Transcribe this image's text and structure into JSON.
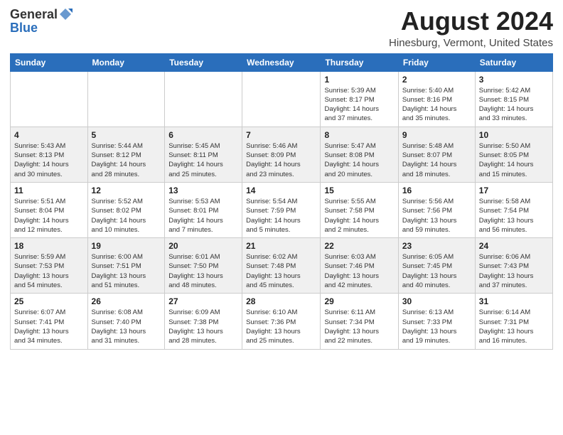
{
  "header": {
    "logo_general": "General",
    "logo_blue": "Blue",
    "title": "August 2024",
    "subtitle": "Hinesburg, Vermont, United States"
  },
  "calendar": {
    "days_of_week": [
      "Sunday",
      "Monday",
      "Tuesday",
      "Wednesday",
      "Thursday",
      "Friday",
      "Saturday"
    ],
    "weeks": [
      [
        {
          "day": "",
          "info": ""
        },
        {
          "day": "",
          "info": ""
        },
        {
          "day": "",
          "info": ""
        },
        {
          "day": "",
          "info": ""
        },
        {
          "day": "1",
          "info": "Sunrise: 5:39 AM\nSunset: 8:17 PM\nDaylight: 14 hours\nand 37 minutes."
        },
        {
          "day": "2",
          "info": "Sunrise: 5:40 AM\nSunset: 8:16 PM\nDaylight: 14 hours\nand 35 minutes."
        },
        {
          "day": "3",
          "info": "Sunrise: 5:42 AM\nSunset: 8:15 PM\nDaylight: 14 hours\nand 33 minutes."
        }
      ],
      [
        {
          "day": "4",
          "info": "Sunrise: 5:43 AM\nSunset: 8:13 PM\nDaylight: 14 hours\nand 30 minutes."
        },
        {
          "day": "5",
          "info": "Sunrise: 5:44 AM\nSunset: 8:12 PM\nDaylight: 14 hours\nand 28 minutes."
        },
        {
          "day": "6",
          "info": "Sunrise: 5:45 AM\nSunset: 8:11 PM\nDaylight: 14 hours\nand 25 minutes."
        },
        {
          "day": "7",
          "info": "Sunrise: 5:46 AM\nSunset: 8:09 PM\nDaylight: 14 hours\nand 23 minutes."
        },
        {
          "day": "8",
          "info": "Sunrise: 5:47 AM\nSunset: 8:08 PM\nDaylight: 14 hours\nand 20 minutes."
        },
        {
          "day": "9",
          "info": "Sunrise: 5:48 AM\nSunset: 8:07 PM\nDaylight: 14 hours\nand 18 minutes."
        },
        {
          "day": "10",
          "info": "Sunrise: 5:50 AM\nSunset: 8:05 PM\nDaylight: 14 hours\nand 15 minutes."
        }
      ],
      [
        {
          "day": "11",
          "info": "Sunrise: 5:51 AM\nSunset: 8:04 PM\nDaylight: 14 hours\nand 12 minutes."
        },
        {
          "day": "12",
          "info": "Sunrise: 5:52 AM\nSunset: 8:02 PM\nDaylight: 14 hours\nand 10 minutes."
        },
        {
          "day": "13",
          "info": "Sunrise: 5:53 AM\nSunset: 8:01 PM\nDaylight: 14 hours\nand 7 minutes."
        },
        {
          "day": "14",
          "info": "Sunrise: 5:54 AM\nSunset: 7:59 PM\nDaylight: 14 hours\nand 5 minutes."
        },
        {
          "day": "15",
          "info": "Sunrise: 5:55 AM\nSunset: 7:58 PM\nDaylight: 14 hours\nand 2 minutes."
        },
        {
          "day": "16",
          "info": "Sunrise: 5:56 AM\nSunset: 7:56 PM\nDaylight: 13 hours\nand 59 minutes."
        },
        {
          "day": "17",
          "info": "Sunrise: 5:58 AM\nSunset: 7:54 PM\nDaylight: 13 hours\nand 56 minutes."
        }
      ],
      [
        {
          "day": "18",
          "info": "Sunrise: 5:59 AM\nSunset: 7:53 PM\nDaylight: 13 hours\nand 54 minutes."
        },
        {
          "day": "19",
          "info": "Sunrise: 6:00 AM\nSunset: 7:51 PM\nDaylight: 13 hours\nand 51 minutes."
        },
        {
          "day": "20",
          "info": "Sunrise: 6:01 AM\nSunset: 7:50 PM\nDaylight: 13 hours\nand 48 minutes."
        },
        {
          "day": "21",
          "info": "Sunrise: 6:02 AM\nSunset: 7:48 PM\nDaylight: 13 hours\nand 45 minutes."
        },
        {
          "day": "22",
          "info": "Sunrise: 6:03 AM\nSunset: 7:46 PM\nDaylight: 13 hours\nand 42 minutes."
        },
        {
          "day": "23",
          "info": "Sunrise: 6:05 AM\nSunset: 7:45 PM\nDaylight: 13 hours\nand 40 minutes."
        },
        {
          "day": "24",
          "info": "Sunrise: 6:06 AM\nSunset: 7:43 PM\nDaylight: 13 hours\nand 37 minutes."
        }
      ],
      [
        {
          "day": "25",
          "info": "Sunrise: 6:07 AM\nSunset: 7:41 PM\nDaylight: 13 hours\nand 34 minutes."
        },
        {
          "day": "26",
          "info": "Sunrise: 6:08 AM\nSunset: 7:40 PM\nDaylight: 13 hours\nand 31 minutes."
        },
        {
          "day": "27",
          "info": "Sunrise: 6:09 AM\nSunset: 7:38 PM\nDaylight: 13 hours\nand 28 minutes."
        },
        {
          "day": "28",
          "info": "Sunrise: 6:10 AM\nSunset: 7:36 PM\nDaylight: 13 hours\nand 25 minutes."
        },
        {
          "day": "29",
          "info": "Sunrise: 6:11 AM\nSunset: 7:34 PM\nDaylight: 13 hours\nand 22 minutes."
        },
        {
          "day": "30",
          "info": "Sunrise: 6:13 AM\nSunset: 7:33 PM\nDaylight: 13 hours\nand 19 minutes."
        },
        {
          "day": "31",
          "info": "Sunrise: 6:14 AM\nSunset: 7:31 PM\nDaylight: 13 hours\nand 16 minutes."
        }
      ]
    ]
  }
}
